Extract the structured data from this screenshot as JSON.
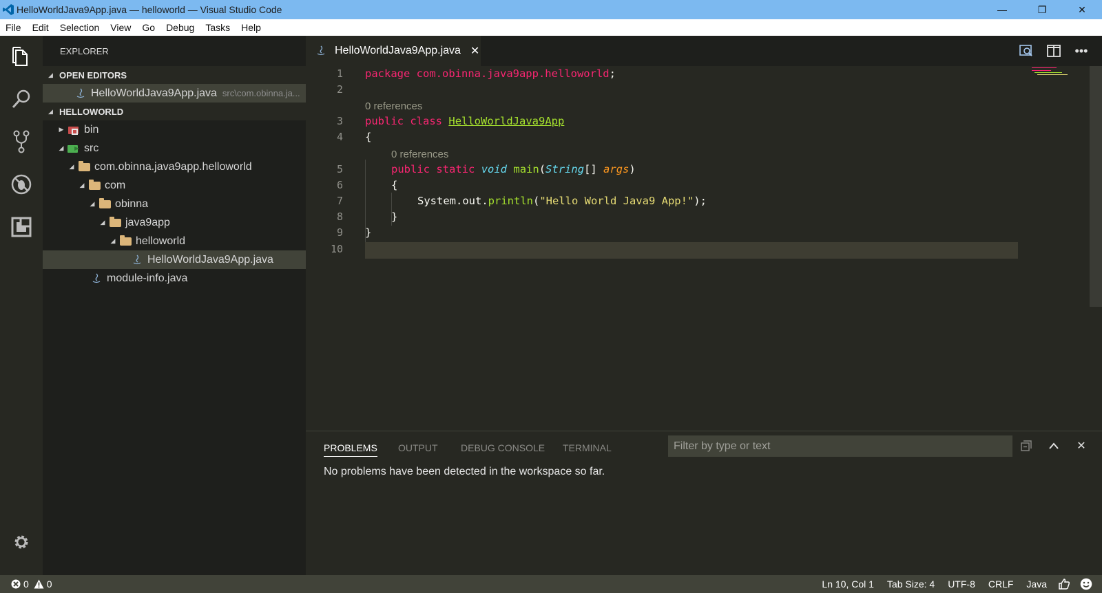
{
  "window": {
    "title": "HelloWorldJava9App.java — helloworld — Visual Studio Code",
    "controls": [
      "—",
      "❐",
      "✕"
    ]
  },
  "menu": [
    "File",
    "Edit",
    "Selection",
    "View",
    "Go",
    "Debug",
    "Tasks",
    "Help"
  ],
  "activity": [
    "explorer-icon",
    "search-icon",
    "source-control-icon",
    "debug-icon",
    "extensions-icon",
    "gear-icon"
  ],
  "sidebar": {
    "header": "EXPLORER",
    "open_editors_title": "OPEN EDITORS",
    "open_editor": {
      "name": "HelloWorldJava9App.java",
      "desc": "src\\com.obinna.ja..."
    },
    "workspace_title": "HELLOWORLD",
    "tree": [
      {
        "label": "bin"
      },
      {
        "label": "src"
      },
      {
        "label": "com.obinna.java9app.helloworld"
      },
      {
        "label": "com"
      },
      {
        "label": "obinna"
      },
      {
        "label": "java9app"
      },
      {
        "label": "helloworld"
      },
      {
        "label": "HelloWorldJava9App.java"
      },
      {
        "label": "module-info.java"
      }
    ]
  },
  "editor": {
    "tab_label": "HelloWorldJava9App.java",
    "lens_text": "0 references",
    "line_numbers": [
      "1",
      "2",
      "3",
      "4",
      "5",
      "6",
      "7",
      "8",
      "9",
      "10"
    ],
    "tokens": {
      "package_kw": "package",
      "package_name": "com.obinna.java9app.helloworld",
      "semicolon": ";",
      "public_kw": "public",
      "class_kw": "class",
      "class_name": "HelloWorldJava9App",
      "open_brace": "{",
      "close_brace": "}",
      "static_kw": "static",
      "void_kw": "void",
      "main_fn": "main",
      "string_type": "String",
      "brackets": "[]",
      "args": "args",
      "lparen": "(",
      "rparen": ")",
      "system_out": "System.out.",
      "println_fn": "println",
      "string_lit": "\"Hello World Java9 App!\"",
      "stmt_end": ");"
    }
  },
  "panel": {
    "tabs": [
      "PROBLEMS",
      "OUTPUT",
      "DEBUG CONSOLE",
      "TERMINAL"
    ],
    "filter_placeholder": "Filter by type or text",
    "message": "No problems have been detected in the workspace so far."
  },
  "status": {
    "errors": "0",
    "warnings": "0",
    "position": "Ln 10, Col 1",
    "tab_size": "Tab Size: 4",
    "encoding": "UTF-8",
    "eol": "CRLF",
    "language": "Java"
  },
  "colors": {
    "titlebar": "#7cb9f0",
    "editor_bg": "#272822",
    "sidebar_bg": "#1e1f1c",
    "keyword": "#f92672",
    "type": "#66d9ef",
    "function": "#a6e22e",
    "string": "#e6db74",
    "argument": "#fd971f"
  }
}
